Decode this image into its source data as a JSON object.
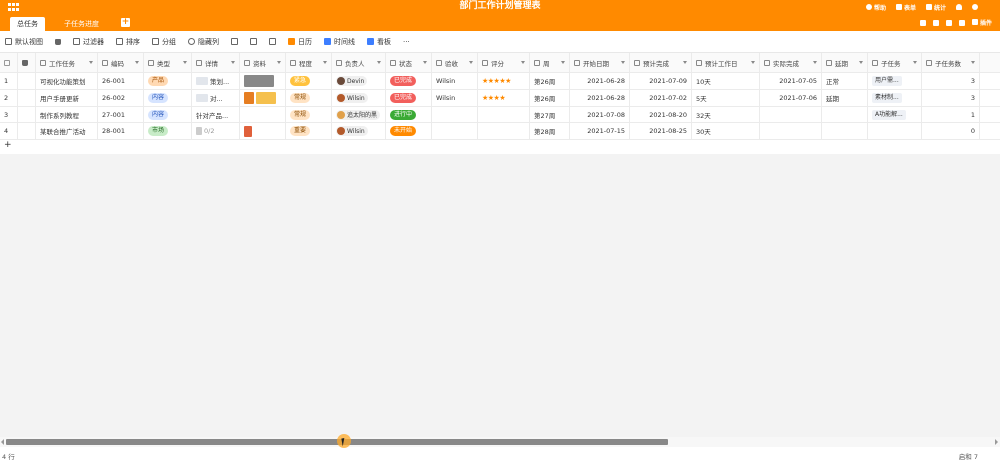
{
  "header": {
    "title": "部门工作计划管理表",
    "actions": [
      "帮助",
      "表单",
      "统计"
    ]
  },
  "tabs": [
    {
      "label": "总任务",
      "active": true
    },
    {
      "label": "子任务进度",
      "active": false
    }
  ],
  "tab_actions": {
    "plugin": "插件"
  },
  "toolbar": {
    "view": "默认视图",
    "filter": "过滤器",
    "sort": "排序",
    "group": "分组",
    "hide_cols": "隐藏列",
    "calendar": "日历",
    "timeline": "时间线",
    "kanban": "看板",
    "more": "···"
  },
  "columns": [
    "工作任务",
    "编码",
    "类型",
    "详情",
    "资料",
    "程度",
    "负责人",
    "状态",
    "验收",
    "评分",
    "周",
    "开始日期",
    "预计完成",
    "预计工作日",
    "实际完成",
    "延期",
    "子任务",
    "子任务数"
  ],
  "rows": [
    {
      "idx": "1",
      "task": "可视化功能策划",
      "code": "26-001",
      "type": "产品",
      "type_color": "orange",
      "detail": "策划...",
      "level": "紧急",
      "level_color": "yellow",
      "owner": "Devin",
      "status": "已完成",
      "status_color": "red",
      "accept": "Wilsin",
      "stars": "★★★★★",
      "week": "第26周",
      "start": "2021-06-28",
      "plan_end": "2021-07-09",
      "plan_days": "10天",
      "actual_end": "2021-07-05",
      "delay": "正常",
      "subtask": "用户需...",
      "subcount": "3"
    },
    {
      "idx": "2",
      "task": "用户手册更新",
      "code": "26-002",
      "type": "内容",
      "type_color": "blue",
      "detail": "对...",
      "level": "常规",
      "level_color": "soft-orange",
      "owner": "Wilsin",
      "status": "已完成",
      "status_color": "red",
      "accept": "Wilsin",
      "stars": "★★★★",
      "week": "第26周",
      "start": "2021-06-28",
      "plan_end": "2021-07-02",
      "plan_days": "5天",
      "actual_end": "2021-07-06",
      "delay": "延期",
      "subtask": "素材制...",
      "subcount": "3"
    },
    {
      "idx": "3",
      "task": "制作系列教程",
      "code": "27-001",
      "type": "内容",
      "type_color": "blue",
      "detail": "针对产品...",
      "level": "常规",
      "level_color": "soft-orange",
      "owner": "追太阳的黑",
      "status": "进行中",
      "status_color": "green-solid",
      "accept": "",
      "stars": "",
      "week": "第27周",
      "start": "2021-07-08",
      "plan_end": "2021-08-20",
      "plan_days": "32天",
      "actual_end": "",
      "delay": "",
      "subtask": "A功能解...",
      "subcount": "1"
    },
    {
      "idx": "4",
      "task": "某联合推广活动",
      "code": "28-001",
      "type": "市场",
      "type_color": "green",
      "detail": "0/2",
      "level": "重要",
      "level_color": "soft-orange",
      "owner": "Wilsin",
      "status": "未开始",
      "status_color": "orange-solid",
      "accept": "",
      "stars": "",
      "week": "第28周",
      "start": "2021-07-15",
      "plan_end": "2021-08-25",
      "plan_days": "30天",
      "actual_end": "",
      "delay": "",
      "subtask": "",
      "subcount": "0"
    }
  ],
  "footer": {
    "row_count": "4 行",
    "right_text": "启和 7"
  },
  "colors": {
    "brand": "#ff8a00"
  }
}
